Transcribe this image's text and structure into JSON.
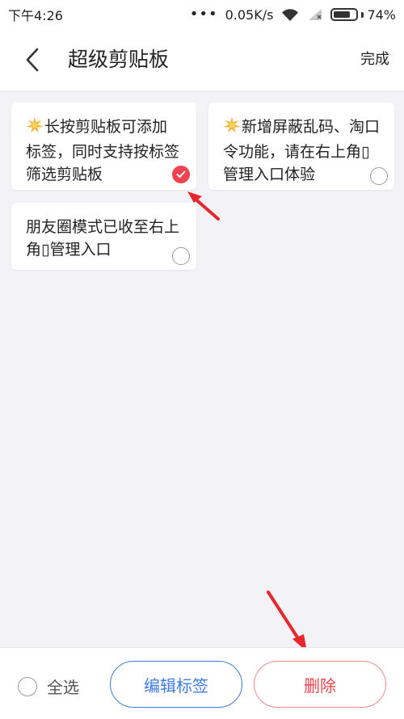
{
  "status_bar": {
    "time": "下午4:26",
    "signal_dots": "•••",
    "speed": "0.05K/s",
    "battery_percent": "74%",
    "battery_level": 0.74
  },
  "header": {
    "title": "超级剪贴板",
    "done_label": "完成"
  },
  "clips": [
    {
      "text": "长按剪贴板可添加标签，同时支持按标签筛选剪贴板",
      "has_star": true,
      "selected": true
    },
    {
      "text": "新增屏蔽乱码、淘口令功能，请在右上角▯管理入口体验",
      "has_star": true,
      "selected": false
    },
    {
      "text": "朋友圈模式已收至右上角▯管理入口",
      "has_star": false,
      "selected": false
    }
  ],
  "bottom": {
    "select_all_label": "全选",
    "edit_tags_label": "编辑标签",
    "delete_label": "删除"
  },
  "colors": {
    "accent_blue": "#3f7ae6",
    "accent_red": "#f1434f"
  }
}
